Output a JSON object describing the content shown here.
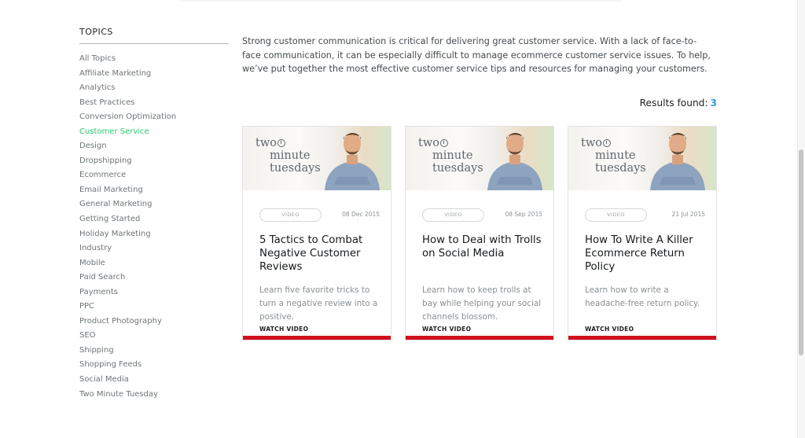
{
  "sidebar": {
    "title": "TOPICS",
    "items": [
      {
        "label": "All Topics"
      },
      {
        "label": "Affiliate Marketing"
      },
      {
        "label": "Analytics"
      },
      {
        "label": "Best Practices"
      },
      {
        "label": "Conversion Optimization"
      },
      {
        "label": "Customer Service",
        "active": true
      },
      {
        "label": "Design"
      },
      {
        "label": "Dropshipping"
      },
      {
        "label": "Ecommerce"
      },
      {
        "label": "Email Marketing"
      },
      {
        "label": "General Marketing"
      },
      {
        "label": "Getting Started"
      },
      {
        "label": "Holiday Marketing"
      },
      {
        "label": "Industry"
      },
      {
        "label": "Mobile"
      },
      {
        "label": "Paid Search"
      },
      {
        "label": "Payments"
      },
      {
        "label": "PPC"
      },
      {
        "label": "Product Photography"
      },
      {
        "label": "SEO"
      },
      {
        "label": "Shipping"
      },
      {
        "label": "Shopping Feeds"
      },
      {
        "label": "Social Media"
      },
      {
        "label": "Two Minute Tuesday"
      }
    ]
  },
  "main": {
    "intro": "Strong customer communication is critical for delivering great customer service. With a lack of face-to-face communication, it can be especially difficult to manage ecommerce customer service issues. To help, we’ve put together the most effective customer service tips and resources for managing your customers.",
    "results_label": "Results found:",
    "results_count": "3"
  },
  "cards": [
    {
      "thumb_line1": "two",
      "thumb_line2": "minute",
      "thumb_line3": "tuesdays",
      "type": "VIDEO",
      "date": "08 Dec 2015",
      "title": "5 Tactics to Combat Negative Customer Reviews",
      "description": "Learn five favorite tricks to turn a negative review into a positive.",
      "cta": "WATCH VIDEO"
    },
    {
      "thumb_line1": "two",
      "thumb_line2": "minute",
      "thumb_line3": "tuesdays",
      "type": "VIDEO",
      "date": "08 Sep 2015",
      "title": "How to Deal with Trolls on Social Media",
      "description": "Learn how to keep trolls at bay while helping your social channels blossom.",
      "cta": "WATCH VIDEO"
    },
    {
      "thumb_line1": "two",
      "thumb_line2": "minute",
      "thumb_line3": "tuesdays",
      "type": "VIDEO",
      "date": "21 Jul 2015",
      "title": "How To Write A Killer Ecommerce Return Policy",
      "description": "Learn how to write a headache-free return policy.",
      "cta": "WATCH VIDEO"
    }
  ],
  "colors": {
    "active_topic": "#2ecc71",
    "results_count": "#2f9bd9",
    "card_bar": "#d0101d"
  }
}
